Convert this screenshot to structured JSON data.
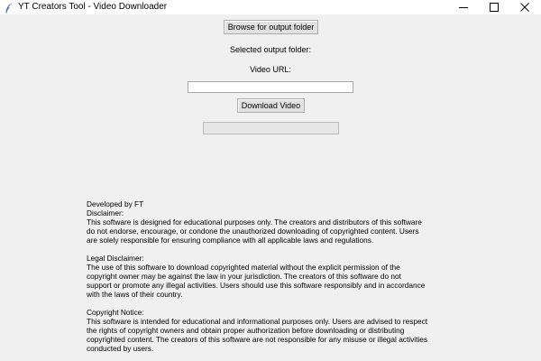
{
  "window": {
    "title": "YT Creators Tool - Video Downloader"
  },
  "controls": {
    "browse_button_label": "Browse for output folder",
    "selected_folder_label": "Selected output folder:",
    "video_url_label": "Video URL:",
    "url_input_value": "",
    "download_button_label": "Download Video",
    "progress_fraction": 0
  },
  "info": {
    "developed_by": "Developed by FT",
    "disclaimer_heading": "Disclaimer:",
    "disclaimer_text": "This software is designed for educational purposes only. The creators and distributors of this software\ndo not endorse, encourage, or condone the unauthorized downloading of copyrighted content. Users\nare solely responsible for ensuring compliance with all applicable laws and regulations.",
    "legal_heading": "Legal Disclaimer:",
    "legal_text": "The use of this software to download copyrighted material without the explicit permission of the\ncopyright owner may be against the law in your jurisdiction. The creators of this software do not\nsupport or promote any illegal activities. Users should use this software responsibly and in accordance\nwith the laws of their country.",
    "copyright_heading": "Copyright Notice:",
    "copyright_text": "This software is intended for educational and informational purposes only. Users are advised to respect\nthe rights of copyright owners and obtain proper authorization before downloading or distributing\ncopyrighted content. The creators of this software are not responsible for any misuse or illegal activities\nconducted by users."
  },
  "icons": {
    "app": "feather-icon",
    "minimize": "minimize-icon",
    "maximize": "maximize-icon",
    "close": "close-icon"
  }
}
